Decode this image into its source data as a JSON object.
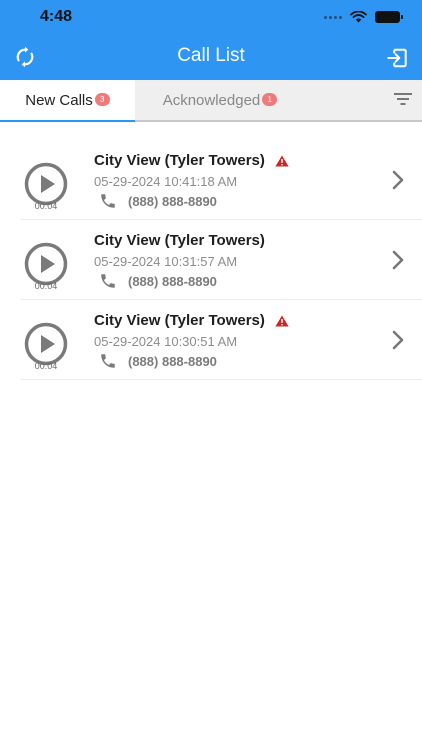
{
  "status_bar": {
    "time": "4:48"
  },
  "nav": {
    "title": "Call List",
    "left_icon": "refresh-icon",
    "right_icon": "logout-icon"
  },
  "tabs": [
    {
      "label": "New Calls",
      "badge": "3",
      "active": true
    },
    {
      "label": "Acknowledged",
      "badge": "1",
      "active": false
    }
  ],
  "calls": [
    {
      "title": "City View (Tyler Towers)",
      "timestamp": "05-29-2024 10:41:18 AM",
      "phone": "(888) 888-8890",
      "duration": "00:04",
      "alert": true
    },
    {
      "title": "City View (Tyler Towers)",
      "timestamp": "05-29-2024 10:31:57 AM",
      "phone": "(888) 888-8890",
      "duration": "00:04",
      "alert": false
    },
    {
      "title": "City View (Tyler Towers)",
      "timestamp": "05-29-2024 10:30:51 AM",
      "phone": "(888) 888-8890",
      "duration": "00:04",
      "alert": true
    }
  ],
  "colors": {
    "header": "#2e95f2",
    "badge": "#f07a7a",
    "alert": "#c62828",
    "icon_gray": "#7b7b7b"
  }
}
